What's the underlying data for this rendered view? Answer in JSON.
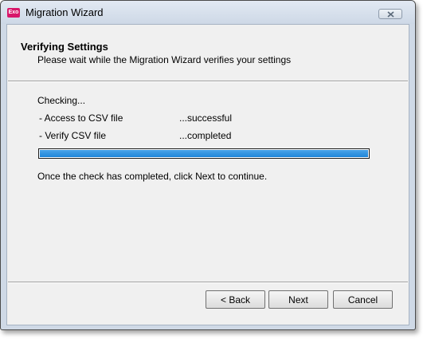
{
  "window": {
    "title": "Migration Wizard",
    "app_icon": "exo-icon",
    "app_icon_label": "Exo"
  },
  "header": {
    "title": "Verifying Settings",
    "subtitle": "Please wait while the Migration Wizard verifies your settings"
  },
  "body": {
    "checking_label": "Checking...",
    "checks": [
      {
        "name": "- Access to CSV file",
        "status": "...successful"
      },
      {
        "name": "- Verify CSV file",
        "status": "...completed"
      }
    ],
    "progress_percent": 100,
    "hint": "Once the check has completed, click Next to continue."
  },
  "buttons": {
    "back_label": "< Back",
    "next_label": "Next",
    "cancel_label": "Cancel"
  },
  "colors": {
    "progress_fill": "#1f86d9",
    "app_icon": "#d8176a"
  }
}
